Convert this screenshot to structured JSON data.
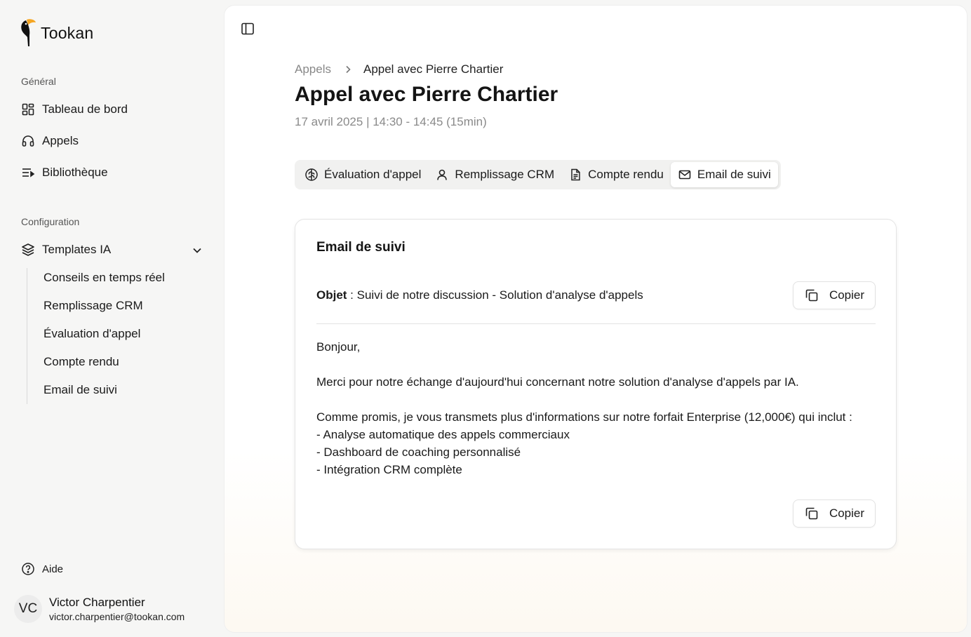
{
  "app": {
    "name": "Tookan",
    "brand_color": "#f5a623"
  },
  "sidebar": {
    "sections": [
      {
        "label": "Général",
        "items": [
          {
            "label": "Tableau de bord",
            "icon": "dashboard-icon"
          },
          {
            "label": "Appels",
            "icon": "headset-icon"
          },
          {
            "label": "Bibliothèque",
            "icon": "library-icon"
          }
        ]
      },
      {
        "label": "Configuration",
        "items": [
          {
            "label": "Templates IA",
            "icon": "layers-icon",
            "expanded": true,
            "children": [
              "Conseils en temps réel",
              "Remplissage CRM",
              "Évaluation d'appel",
              "Compte rendu",
              "Email de suivi"
            ]
          }
        ]
      }
    ],
    "help_label": "Aide",
    "user": {
      "initials": "VC",
      "name": "Victor Charpentier",
      "email": "victor.charpentier@tookan.com"
    }
  },
  "breadcrumb": {
    "parent": "Appels",
    "current": "Appel avec Pierre Chartier"
  },
  "page": {
    "title": "Appel avec Pierre Chartier",
    "meta": "17 avril 2025 | 14:30 - 14:45 (15min)"
  },
  "tabs": [
    {
      "label": "Évaluation d'appel",
      "icon": "brain-icon",
      "active": false
    },
    {
      "label": "Remplissage CRM",
      "icon": "user-icon",
      "active": false
    },
    {
      "label": "Compte rendu",
      "icon": "document-icon",
      "active": false
    },
    {
      "label": "Email de suivi",
      "icon": "mail-icon",
      "active": true
    }
  ],
  "email": {
    "title": "Email de suivi",
    "subject_label": "Objet",
    "subject": " : Suivi de notre discussion - Solution d'analyse d'appels",
    "copy_label": "Copier",
    "body_lines": [
      "Bonjour,",
      "Merci pour notre échange d'aujourd'hui concernant notre solution d'analyse d'appels par IA.",
      "Comme promis, je vous transmets plus d'informations sur notre forfait Enterprise (12,000€) qui inclut :",
      "- Analyse automatique des appels commerciaux",
      "- Dashboard de coaching personnalisé",
      "- Intégration CRM complète"
    ]
  }
}
